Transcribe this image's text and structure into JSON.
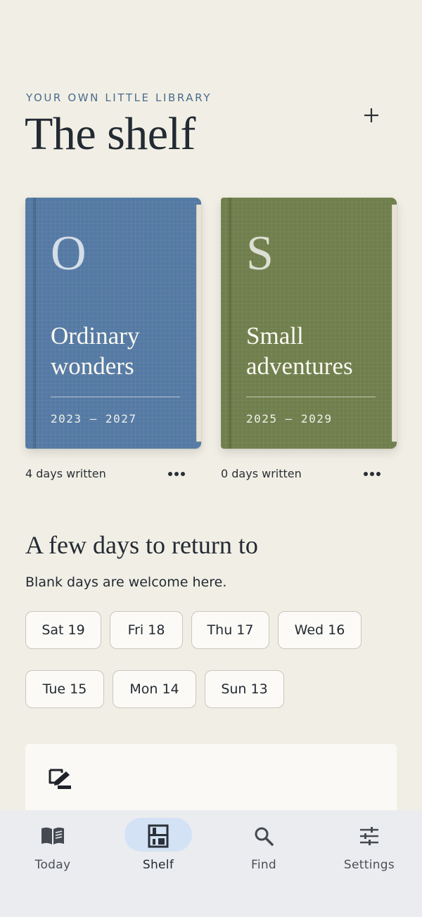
{
  "header": {
    "eyebrow": "YOUR OWN LITTLE LIBRARY",
    "title": "The shelf"
  },
  "books": [
    {
      "initial": "O",
      "title": "Ordinary wonders",
      "years": "2023 — 2027",
      "meta": "4 days written",
      "color": "#5479a3"
    },
    {
      "initial": "S",
      "title": "Small adventures",
      "years": "2025 — 2029",
      "meta": "0 days written",
      "color": "#6f7e4c"
    }
  ],
  "return_section": {
    "title": "A few days to return to",
    "subtitle": "Blank days are welcome here.",
    "days": [
      "Sat 19",
      "Fri 18",
      "Thu 17",
      "Wed 16",
      "Tue 15",
      "Mon 14",
      "Sun 13"
    ]
  },
  "nav": {
    "items": [
      {
        "label": "Today",
        "icon": "book-open-icon"
      },
      {
        "label": "Shelf",
        "icon": "shelf-icon"
      },
      {
        "label": "Find",
        "icon": "search-icon"
      },
      {
        "label": "Settings",
        "icon": "sliders-icon"
      }
    ],
    "active": "Shelf"
  }
}
